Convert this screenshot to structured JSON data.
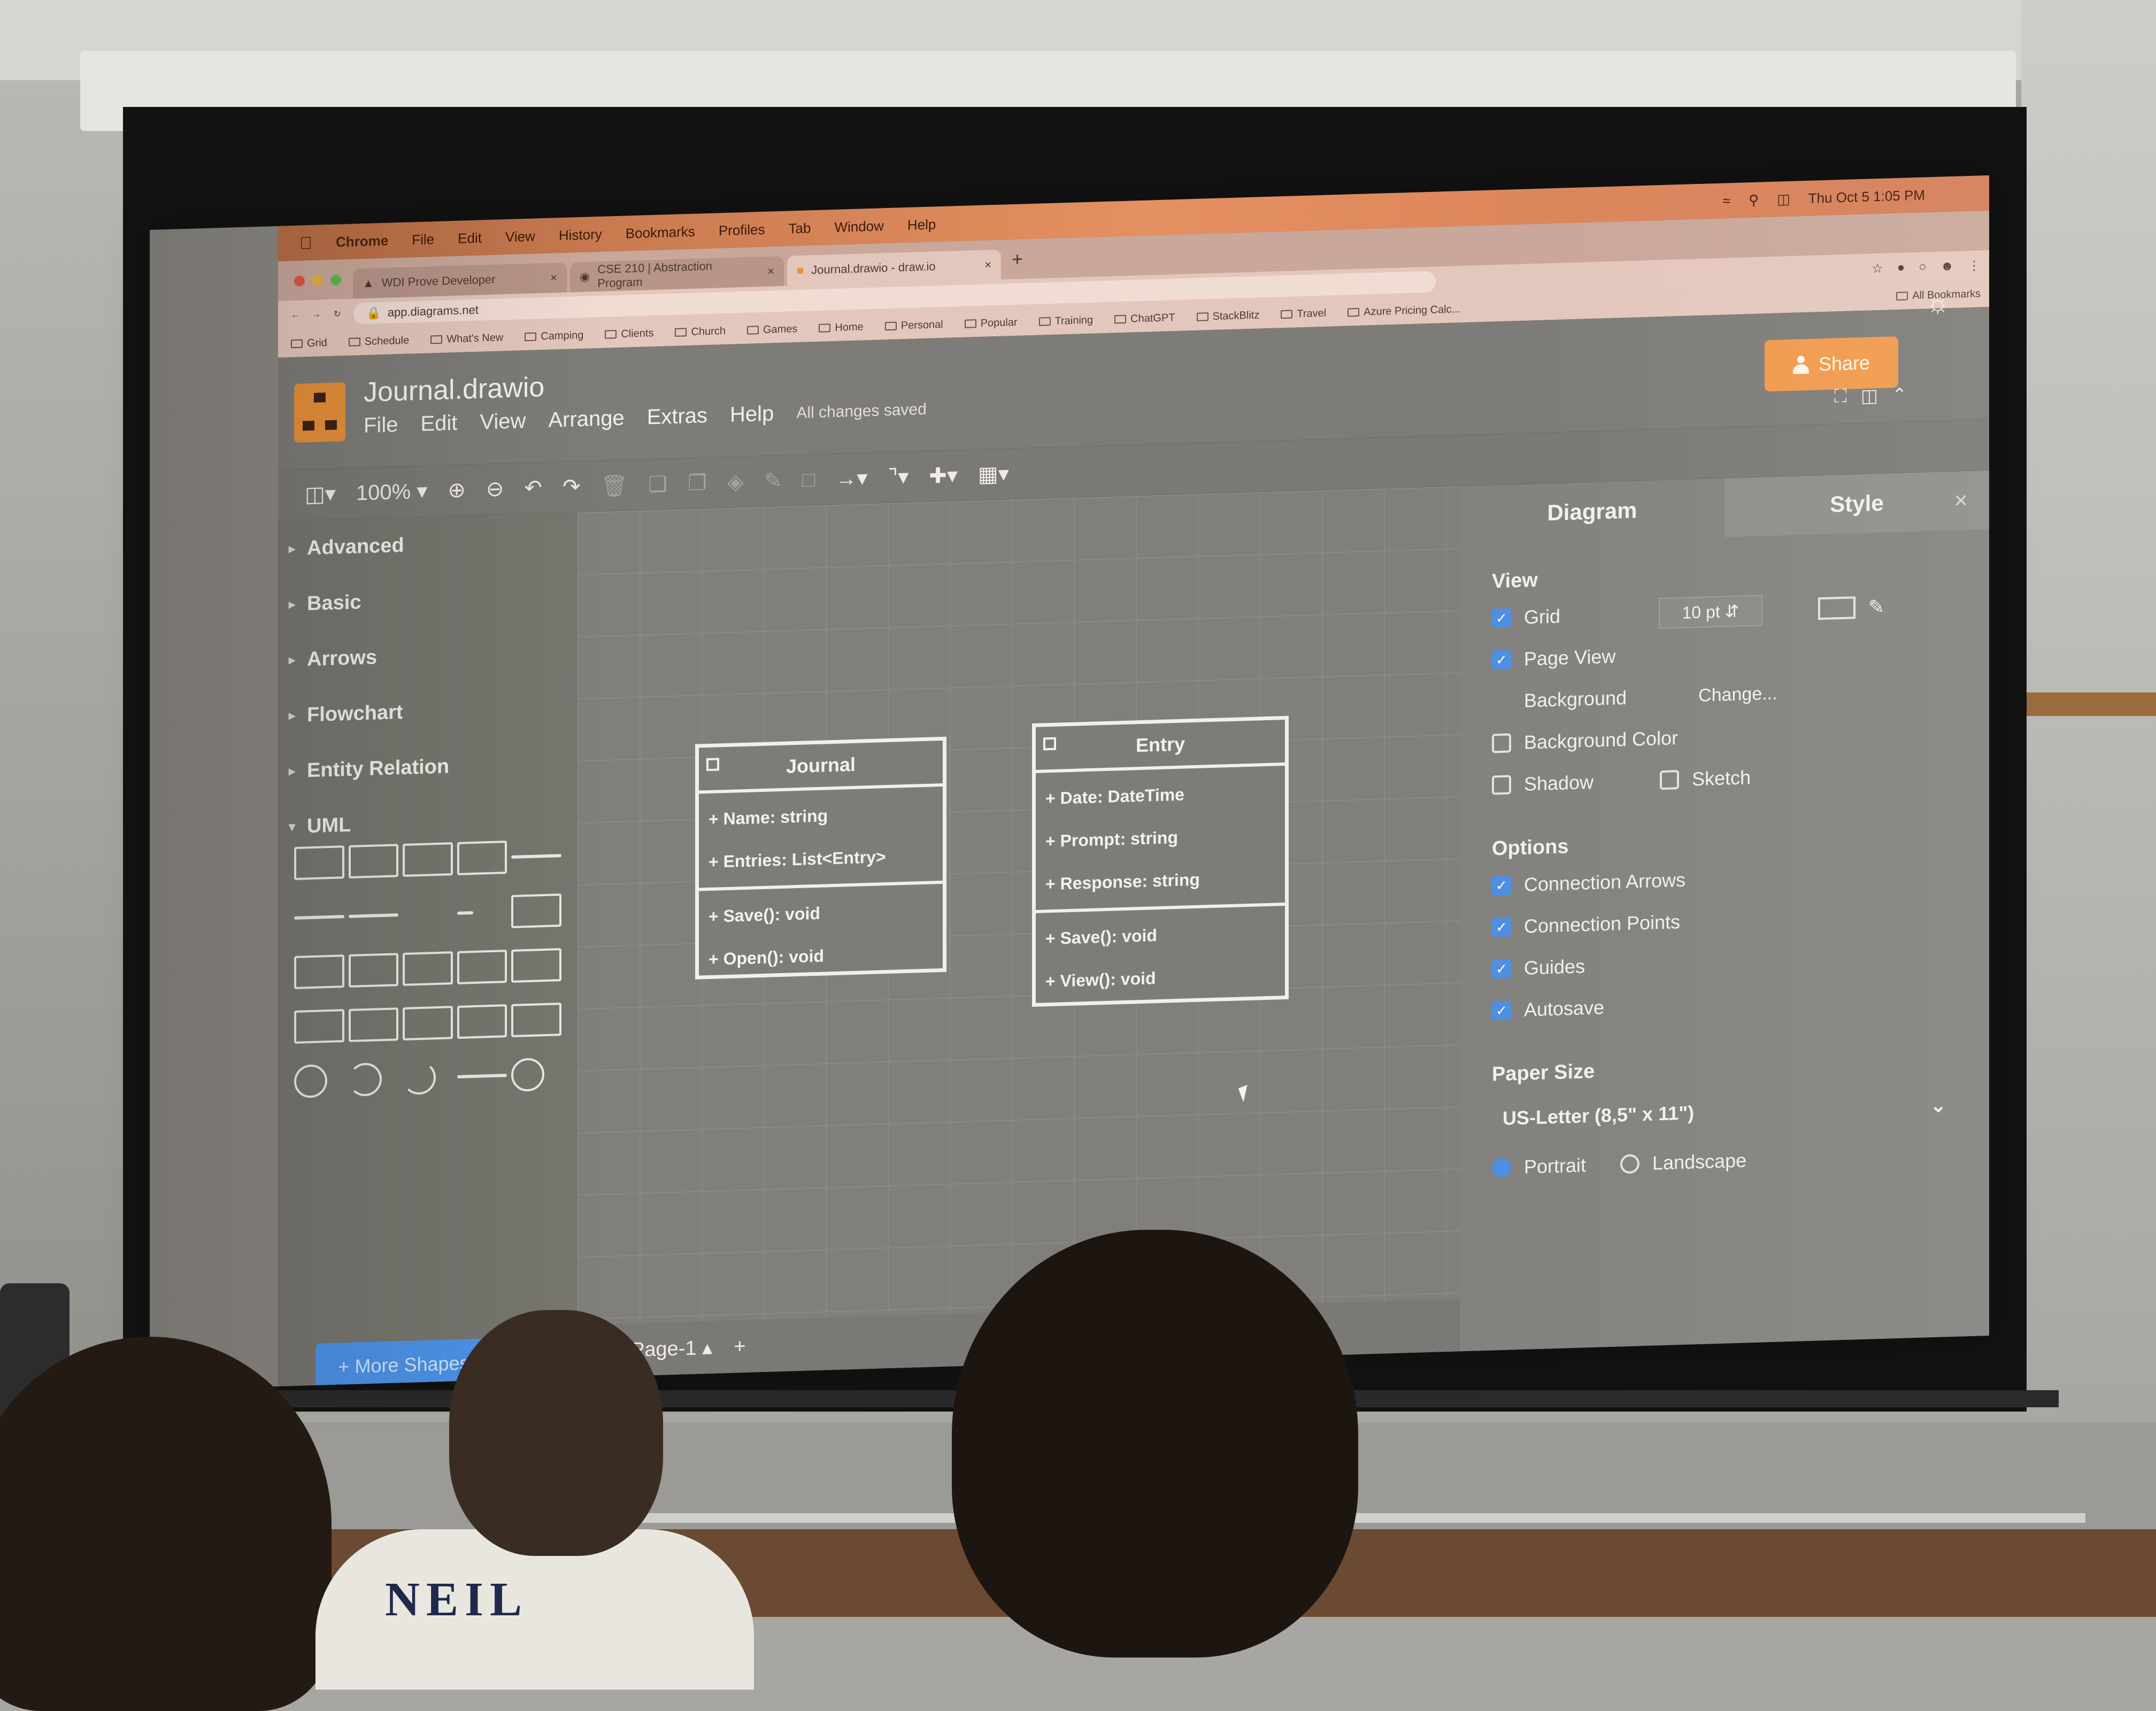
{
  "menubar": {
    "app": "Chrome",
    "items": [
      "File",
      "Edit",
      "View",
      "History",
      "Bookmarks",
      "Profiles",
      "Tab",
      "Window",
      "Help"
    ],
    "clock": "Thu Oct 5  1:05 PM"
  },
  "browser": {
    "tabs": [
      {
        "title": "WDI Prove Developer"
      },
      {
        "title": "CSE 210 | Abstraction Program"
      },
      {
        "title": "Journal.drawio - draw.io"
      }
    ],
    "url": "app.diagrams.net",
    "bookmarks": [
      "Grid",
      "Schedule",
      "What's New",
      "Camping",
      "Clients",
      "Church",
      "Games",
      "Home",
      "Personal",
      "Popular",
      "Training",
      "ChatGPT",
      "StackBlitz",
      "Travel",
      "Azure Pricing Calc..."
    ],
    "all_bookmarks": "All Bookmarks"
  },
  "app": {
    "file_title": "Journal.drawio",
    "menu": [
      "File",
      "Edit",
      "View",
      "Arrange",
      "Extras",
      "Help"
    ],
    "save_status": "All changes saved",
    "share_label": "Share",
    "zoom": "100%"
  },
  "left_panel": {
    "sections": [
      "Advanced",
      "Basic",
      "Arrows",
      "Flowchart",
      "Entity Relation",
      "UML"
    ],
    "more_shapes": "+ More Shapes"
  },
  "diagram": {
    "classes": [
      {
        "name": "Journal",
        "attributes": [
          "+ Name: string",
          "+ Entries: List<Entry>"
        ],
        "methods": [
          "+ Save(): void",
          "+ Open(): void"
        ]
      },
      {
        "name": "Entry",
        "attributes": [
          "+ Date: DateTime",
          "+ Prompt: string",
          "+ Response: string"
        ],
        "methods": [
          "+ Save(): void",
          "+ View(): void"
        ]
      }
    ]
  },
  "page_tabs": {
    "current": "Page-1",
    "add": "+"
  },
  "format_panel": {
    "tabs": [
      "Diagram",
      "Style"
    ],
    "view_heading": "View",
    "grid_label": "Grid",
    "grid_size": "10 pt",
    "page_view_label": "Page View",
    "background_label": "Background",
    "change_label": "Change...",
    "background_color_label": "Background Color",
    "shadow_label": "Shadow",
    "sketch_label": "Sketch",
    "options_heading": "Options",
    "options": [
      "Connection Arrows",
      "Connection Points",
      "Guides",
      "Autosave"
    ],
    "paper_size_heading": "Paper Size",
    "paper_size": "US-Letter (8,5\" x 11\")",
    "portrait_label": "Portrait",
    "landscape_label": "Landscape",
    "checkbox_states": {
      "grid": true,
      "page_view": true,
      "background_color": false,
      "shadow": false,
      "sketch": false,
      "connection_arrows": true,
      "connection_points": true,
      "guides": true,
      "autosave": true
    },
    "orientation": "Portrait"
  },
  "shirt_text": "NEIL",
  "colors": {
    "accent": "#f09a4c",
    "checkbox_blue": "#4e8fe2",
    "menubar": "#e59061"
  }
}
